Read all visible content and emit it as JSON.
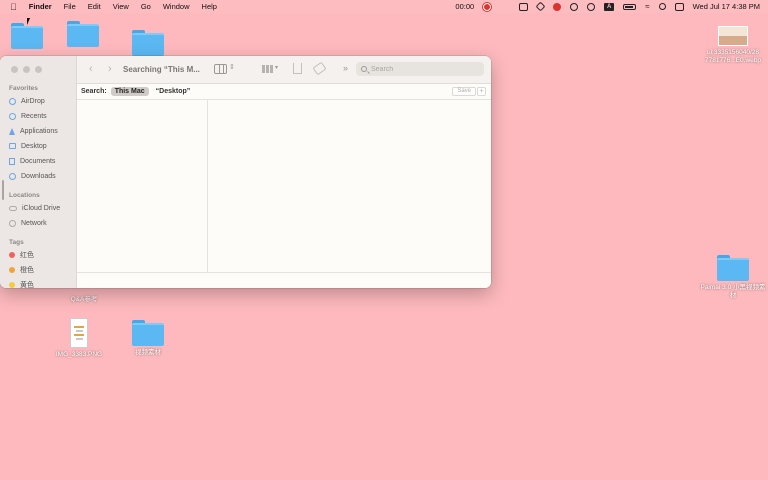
{
  "menubar": {
    "apple": "",
    "app_name": "Finder",
    "menus": [
      "File",
      "Edit",
      "View",
      "Go",
      "Window",
      "Help"
    ],
    "recording_time": "00:00",
    "datetime": "Wed Jul 17  4:38 PM",
    "status_icons": [
      "screen-record-icon",
      "app-icon-1",
      "app-icon-2",
      "app-icon-3",
      "chat-icon",
      "play-icon",
      "input-source-icon",
      "battery-icon",
      "wifi-icon",
      "search-icon",
      "control-center-icon"
    ]
  },
  "desktop": {
    "icons": [
      {
        "name": "folder-1",
        "label": ""
      },
      {
        "name": "folder-2",
        "label": ""
      },
      {
        "name": "folder-3",
        "label": ""
      },
      {
        "name": "image-file",
        "label_line1": "ui:3335156040/28",
        "label_line2": "7781776...E0.webp"
      },
      {
        "name": "folder-paimai",
        "label_line1": "Paimai 3.0 小黑视频素",
        "label_line2": "材"
      },
      {
        "name": "qa-file",
        "label": "Q&A参考"
      },
      {
        "name": "img-file",
        "label": "IMG_3383.PNG"
      },
      {
        "name": "video-folder",
        "label": "视频素材"
      }
    ]
  },
  "finder": {
    "title": "Searching “This M...",
    "search_placeholder": "Search",
    "sidebar": {
      "favorites_label": "Favorites",
      "favorites": [
        "AirDrop",
        "Recents",
        "Applications",
        "Desktop",
        "Documents",
        "Downloads"
      ],
      "locations_label": "Locations",
      "locations": [
        "iCloud Drive",
        "Network"
      ],
      "tags_label": "Tags",
      "tags": [
        {
          "label": "红色",
          "color": "#f0625a"
        },
        {
          "label": "橙色",
          "color": "#f3a33a"
        },
        {
          "label": "黄色",
          "color": "#f1cc3c"
        }
      ]
    },
    "scope": {
      "label": "Search:",
      "this_mac": "This Mac",
      "desktop": "“Desktop”",
      "save": "Save",
      "plus": "+"
    }
  }
}
